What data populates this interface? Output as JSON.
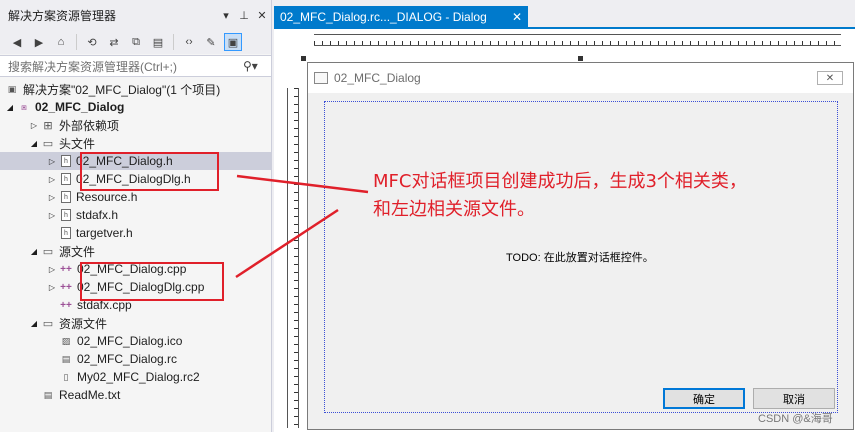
{
  "solution_explorer": {
    "title": "解决方案资源管理器",
    "search_placeholder": "搜索解决方案资源管理器(Ctrl+;)",
    "solution_label": "解决方案\"02_MFC_Dialog\"(1 个项目)",
    "project_label": "02_MFC_Dialog",
    "items": [
      {
        "label": "外部依赖项"
      },
      {
        "label": "头文件"
      },
      {
        "label": "02_MFC_Dialog.h"
      },
      {
        "label": "02_MFC_DialogDlg.h"
      },
      {
        "label": "Resource.h"
      },
      {
        "label": "stdafx.h"
      },
      {
        "label": "targetver.h"
      },
      {
        "label": "源文件"
      },
      {
        "label": "02_MFC_Dialog.cpp"
      },
      {
        "label": "02_MFC_DialogDlg.cpp"
      },
      {
        "label": "stdafx.cpp"
      },
      {
        "label": "资源文件"
      },
      {
        "label": "02_MFC_Dialog.ico"
      },
      {
        "label": "02_MFC_Dialog.rc"
      },
      {
        "label": "My02_MFC_Dialog.rc2"
      },
      {
        "label": "ReadMe.txt"
      }
    ]
  },
  "editor": {
    "tab_label": "02_MFC_Dialog.rc..._DIALOG - Dialog",
    "dialog_title": "02_MFC_Dialog",
    "todo_text": "TODO: 在此放置对话框控件。",
    "ok_label": "确定",
    "cancel_label": "取消"
  },
  "annotation": {
    "line1": "MFC对话框项目创建成功后，生成3个相关类，",
    "line2": "和左边相关源文件。"
  },
  "watermark": "CSDN @&海哥",
  "colors": {
    "accent": "#007acc",
    "annotation": "#e0202a"
  }
}
